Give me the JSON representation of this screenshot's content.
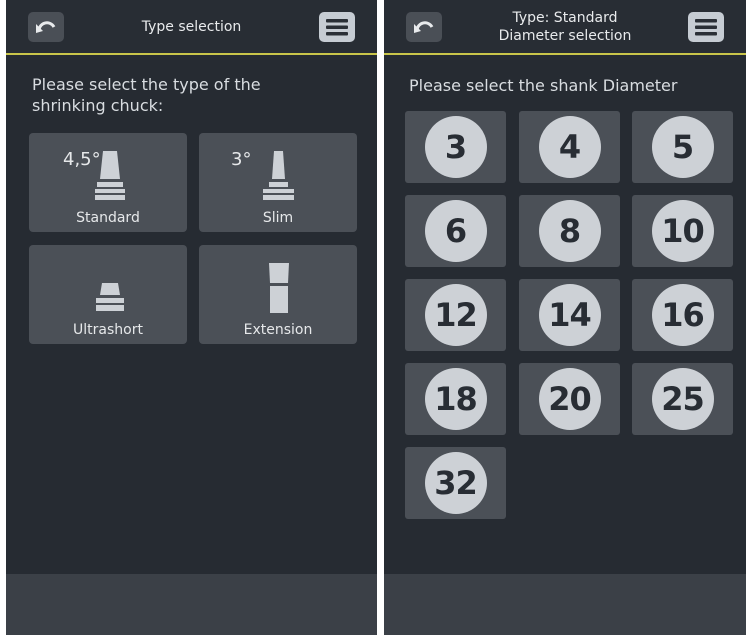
{
  "left_screen": {
    "header_title": "Type selection",
    "prompt_line1": "Please select the type of the",
    "prompt_line2": "shrinking chuck:",
    "types": [
      {
        "label": "Standard",
        "angle": "4,5°"
      },
      {
        "label": "Slim",
        "angle": "3°"
      },
      {
        "label": "Ultrashort",
        "angle": ""
      },
      {
        "label": "Extension",
        "angle": ""
      }
    ]
  },
  "right_screen": {
    "header_title_line1": "Type: Standard",
    "header_title_line2": "Diameter selection",
    "prompt": "Please select the shank Diameter",
    "diameters": [
      "3",
      "4",
      "5",
      "6",
      "8",
      "10",
      "12",
      "14",
      "16",
      "18",
      "20",
      "25",
      "32"
    ]
  },
  "icons": {
    "back": "undo-arrow-icon",
    "menu": "hamburger-menu-icon"
  },
  "colors": {
    "background": "#262b32",
    "tile": "#4b5057",
    "accent_line": "#c9c54a",
    "circle": "#cdd1d6",
    "footer": "#3b4047"
  }
}
